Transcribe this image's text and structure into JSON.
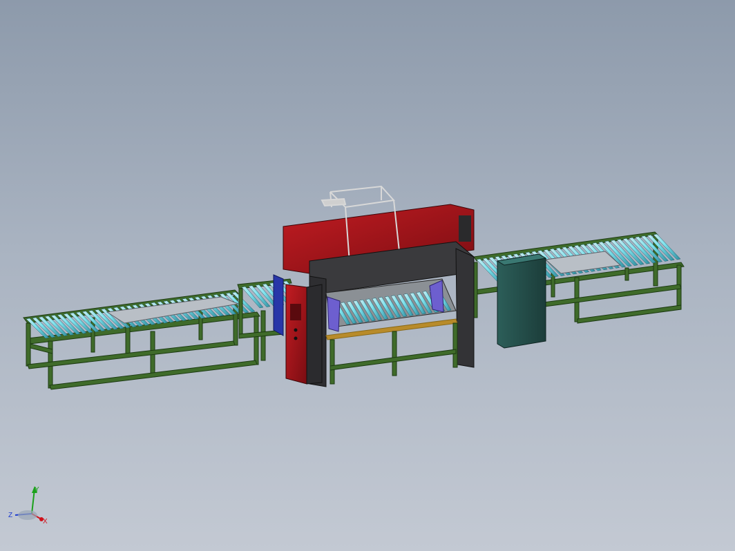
{
  "colors": {
    "frame": "#2f5a20",
    "frame_light": "#4a7d32",
    "roller": "#7fe3ee",
    "roller_dark": "#2f8ea0",
    "machine_body": "#3a3a3d",
    "red": "#a8141a",
    "cabinet": "#27534f",
    "blue_panel": "#2836a8",
    "axis_x": "#d0101a",
    "axis_y": "#1aa11a",
    "axis_z": "#1a3ad0"
  },
  "icons": {
    "triad": "coordinate-triad-icon"
  },
  "triad": {
    "y_label": "Y",
    "z_label": "Z",
    "x_label": "X"
  }
}
